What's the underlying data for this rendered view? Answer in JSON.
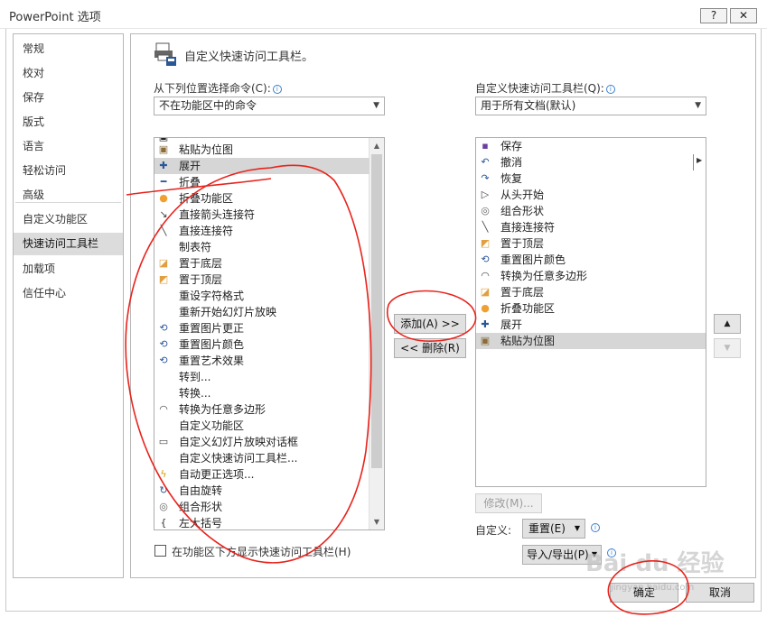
{
  "window": {
    "title": "PowerPoint 选项",
    "help_label": "?",
    "close_label": "✕"
  },
  "nav": {
    "items": [
      "常规",
      "校对",
      "保存",
      "版式",
      "语言",
      "轻松访问",
      "高级",
      "自定义功能区",
      "快速访问工具栏",
      "加载项",
      "信任中心"
    ],
    "selected": "快速访问工具栏"
  },
  "header": {
    "title": "自定义快速访问工具栏。",
    "icon": "quick-access-toolbar-icon"
  },
  "left_panel": {
    "label": "从下列位置选择命令(C):",
    "dropdown_value": "不在功能区中的命令",
    "commands": [
      {
        "label": "粘贴为位图",
        "icon": "paste-picture-icon"
      },
      {
        "label": "展开",
        "icon": "plus-icon"
      },
      {
        "label": "折叠",
        "icon": "minus-icon"
      },
      {
        "label": "折叠功能区",
        "icon": "dot-icon"
      },
      {
        "label": "直接箭头连接符",
        "icon": "arrow-connector-icon"
      },
      {
        "label": "直接连接符",
        "icon": "line-connector-icon"
      },
      {
        "label": "制表符",
        "icon": ""
      },
      {
        "label": "置于底层",
        "icon": "send-to-back-icon"
      },
      {
        "label": "置于顶层",
        "icon": "bring-to-front-icon"
      },
      {
        "label": "重设字符格式",
        "icon": ""
      },
      {
        "label": "重新开始幻灯片放映",
        "icon": ""
      },
      {
        "label": "重置图片更正",
        "icon": "reset-picture-icon"
      },
      {
        "label": "重置图片颜色",
        "icon": "reset-picture-icon"
      },
      {
        "label": "重置艺术效果",
        "icon": "reset-picture-icon"
      },
      {
        "label": "转到...",
        "icon": ""
      },
      {
        "label": "转换...",
        "icon": ""
      },
      {
        "label": "转换为任意多边形",
        "icon": "freeform-icon"
      },
      {
        "label": "自定义功能区",
        "icon": ""
      },
      {
        "label": "自定义幻灯片放映对话框",
        "icon": "slideshow-dialog-icon"
      },
      {
        "label": "自定义快速访问工具栏...",
        "icon": ""
      },
      {
        "label": "自动更正选项...",
        "icon": "autocorrect-icon"
      },
      {
        "label": "自由旋转",
        "icon": "rotate-icon"
      },
      {
        "label": "组合形状",
        "icon": "combine-shapes-icon"
      },
      {
        "label": "左大括号",
        "icon": "brace-icon"
      }
    ],
    "highlighted_index": 1,
    "ribbon_below_label": "在功能区下方显示快速访问工具栏(H)"
  },
  "middle": {
    "add_label": "添加(A) >>",
    "remove_label": "<< 删除(R)"
  },
  "right_panel": {
    "label": "自定义快速访问工具栏(Q):",
    "dropdown_value": "用于所有文档(默认)",
    "items": [
      {
        "label": "保存",
        "icon": "save-icon"
      },
      {
        "label": "撤消",
        "icon": "undo-icon"
      },
      {
        "label": "恢复",
        "icon": "redo-icon"
      },
      {
        "label": "从头开始",
        "icon": "start-from-beginning-icon"
      },
      {
        "label": "组合形状",
        "icon": "combine-shapes-icon"
      },
      {
        "label": "直接连接符",
        "icon": "line-connector-icon"
      },
      {
        "label": "置于顶层",
        "icon": "bring-to-front-icon"
      },
      {
        "label": "重置图片颜色",
        "icon": "reset-picture-icon"
      },
      {
        "label": "转换为任意多边形",
        "icon": "freeform-icon"
      },
      {
        "label": "置于底层",
        "icon": "send-to-back-icon"
      },
      {
        "label": "折叠功能区",
        "icon": "dot-icon"
      },
      {
        "label": "展开",
        "icon": "plus-icon"
      },
      {
        "label": "粘贴为位图",
        "icon": "paste-picture-icon"
      }
    ],
    "highlighted_index": 12,
    "modify_label": "修改(M)...",
    "customize_label": "自定义:",
    "reset_label": "重置(E)",
    "import_export_label": "导入/导出(P)"
  },
  "footer": {
    "ok_label": "确定",
    "cancel_label": "取消"
  },
  "watermark": {
    "brand": "Bai du 经验",
    "url": "jingyan.baidu.com"
  },
  "colors": {
    "annotation": "#e8231c",
    "accent_blue": "#2b5797",
    "selection": "#d6d6d6"
  }
}
